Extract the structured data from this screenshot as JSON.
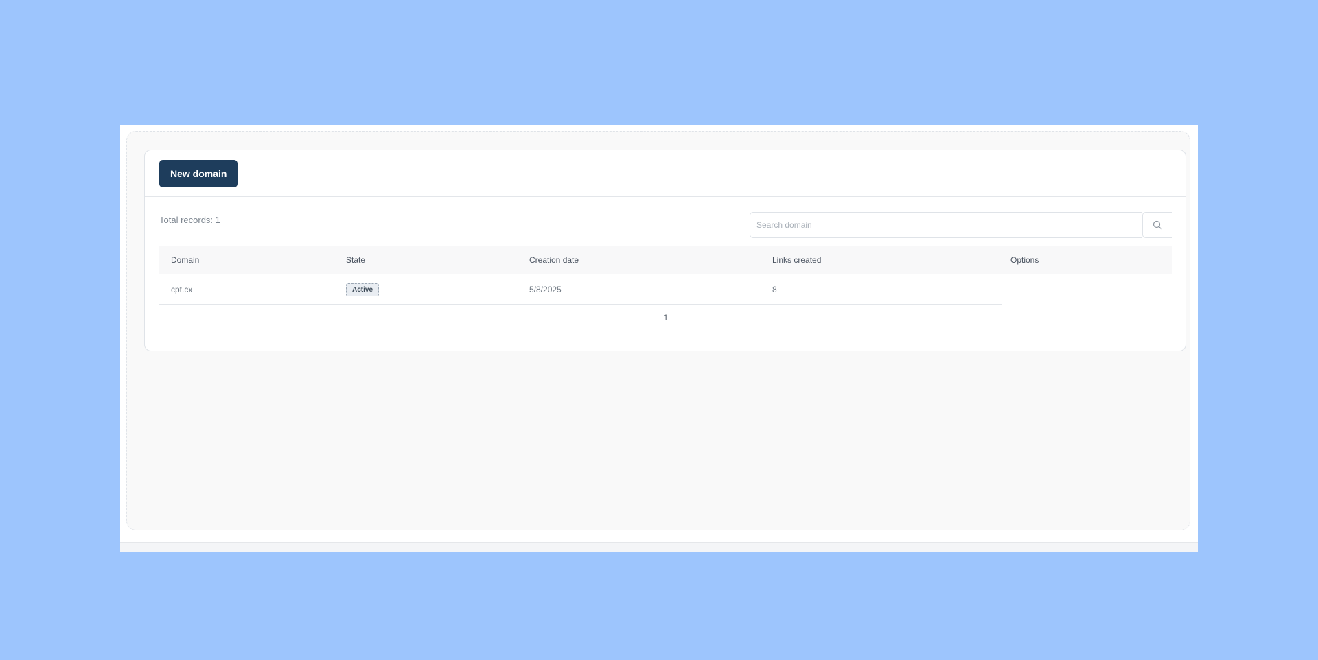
{
  "toolbar": {
    "new_domain_label": "New domain"
  },
  "summary": {
    "total_records": "Total records: 1"
  },
  "search": {
    "placeholder": "Search domain",
    "value": ""
  },
  "table": {
    "headers": [
      "Domain",
      "State",
      "Creation date",
      "Links created",
      "Options"
    ],
    "rows": [
      {
        "domain": "cpt.cx",
        "state": "Active",
        "creation_date": "5/8/2025",
        "links_created": "8",
        "options": ""
      }
    ]
  },
  "pagination": {
    "current_page": "1"
  },
  "colors": {
    "background": "#9dc5fd",
    "primary_button": "#1e3d5c",
    "badge_bg": "#e9edf2"
  },
  "icons": {
    "search_button": "search-icon"
  }
}
